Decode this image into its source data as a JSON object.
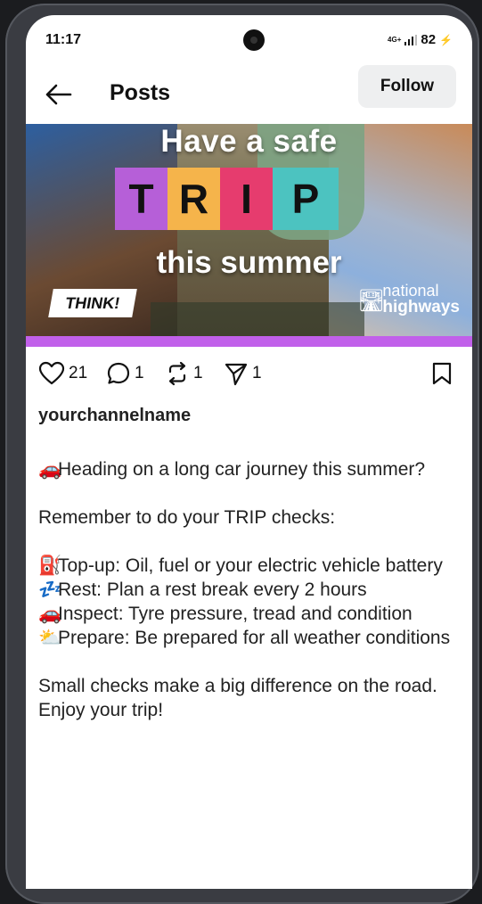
{
  "status": {
    "time": "11:17",
    "network": "4G+",
    "battery": "82"
  },
  "header": {
    "title": "Posts",
    "follow_label": "Follow"
  },
  "banner": {
    "line1": "Have a safe",
    "trip_letters": [
      "T",
      "R",
      "I",
      "P"
    ],
    "line3": "this summer",
    "think_logo": "THINK!",
    "brand_line1": "national",
    "brand_line2": "highways"
  },
  "actions": {
    "likes": "21",
    "comments": "1",
    "reposts": "1",
    "shares": "1"
  },
  "post": {
    "username": "yourchannelname",
    "caption": {
      "p1_emoji": "🚗",
      "p1": "Heading on a long car journey this summer?",
      "p2": "Remember to do your TRIP checks:",
      "l1_emoji": "⛽",
      "l1": "Top-up: Oil, fuel or your electric vehicle battery",
      "l2_emoji": "💤",
      "l2": "Rest: Plan a rest break every 2 hours",
      "l3_emoji": "🚗",
      "l3": "Inspect: Tyre pressure, tread and condition",
      "l4_emoji": "⛅",
      "l4": "Prepare: Be prepared for all weather conditions",
      "p4": "Small checks make a big difference on the road. Enjoy your trip!"
    }
  },
  "colors": {
    "trip_t": "#b65fd8",
    "trip_r": "#f5b44b",
    "trip_i": "#e63c6e",
    "trip_p": "#4cc3c0",
    "stripe": "#c160ea"
  }
}
